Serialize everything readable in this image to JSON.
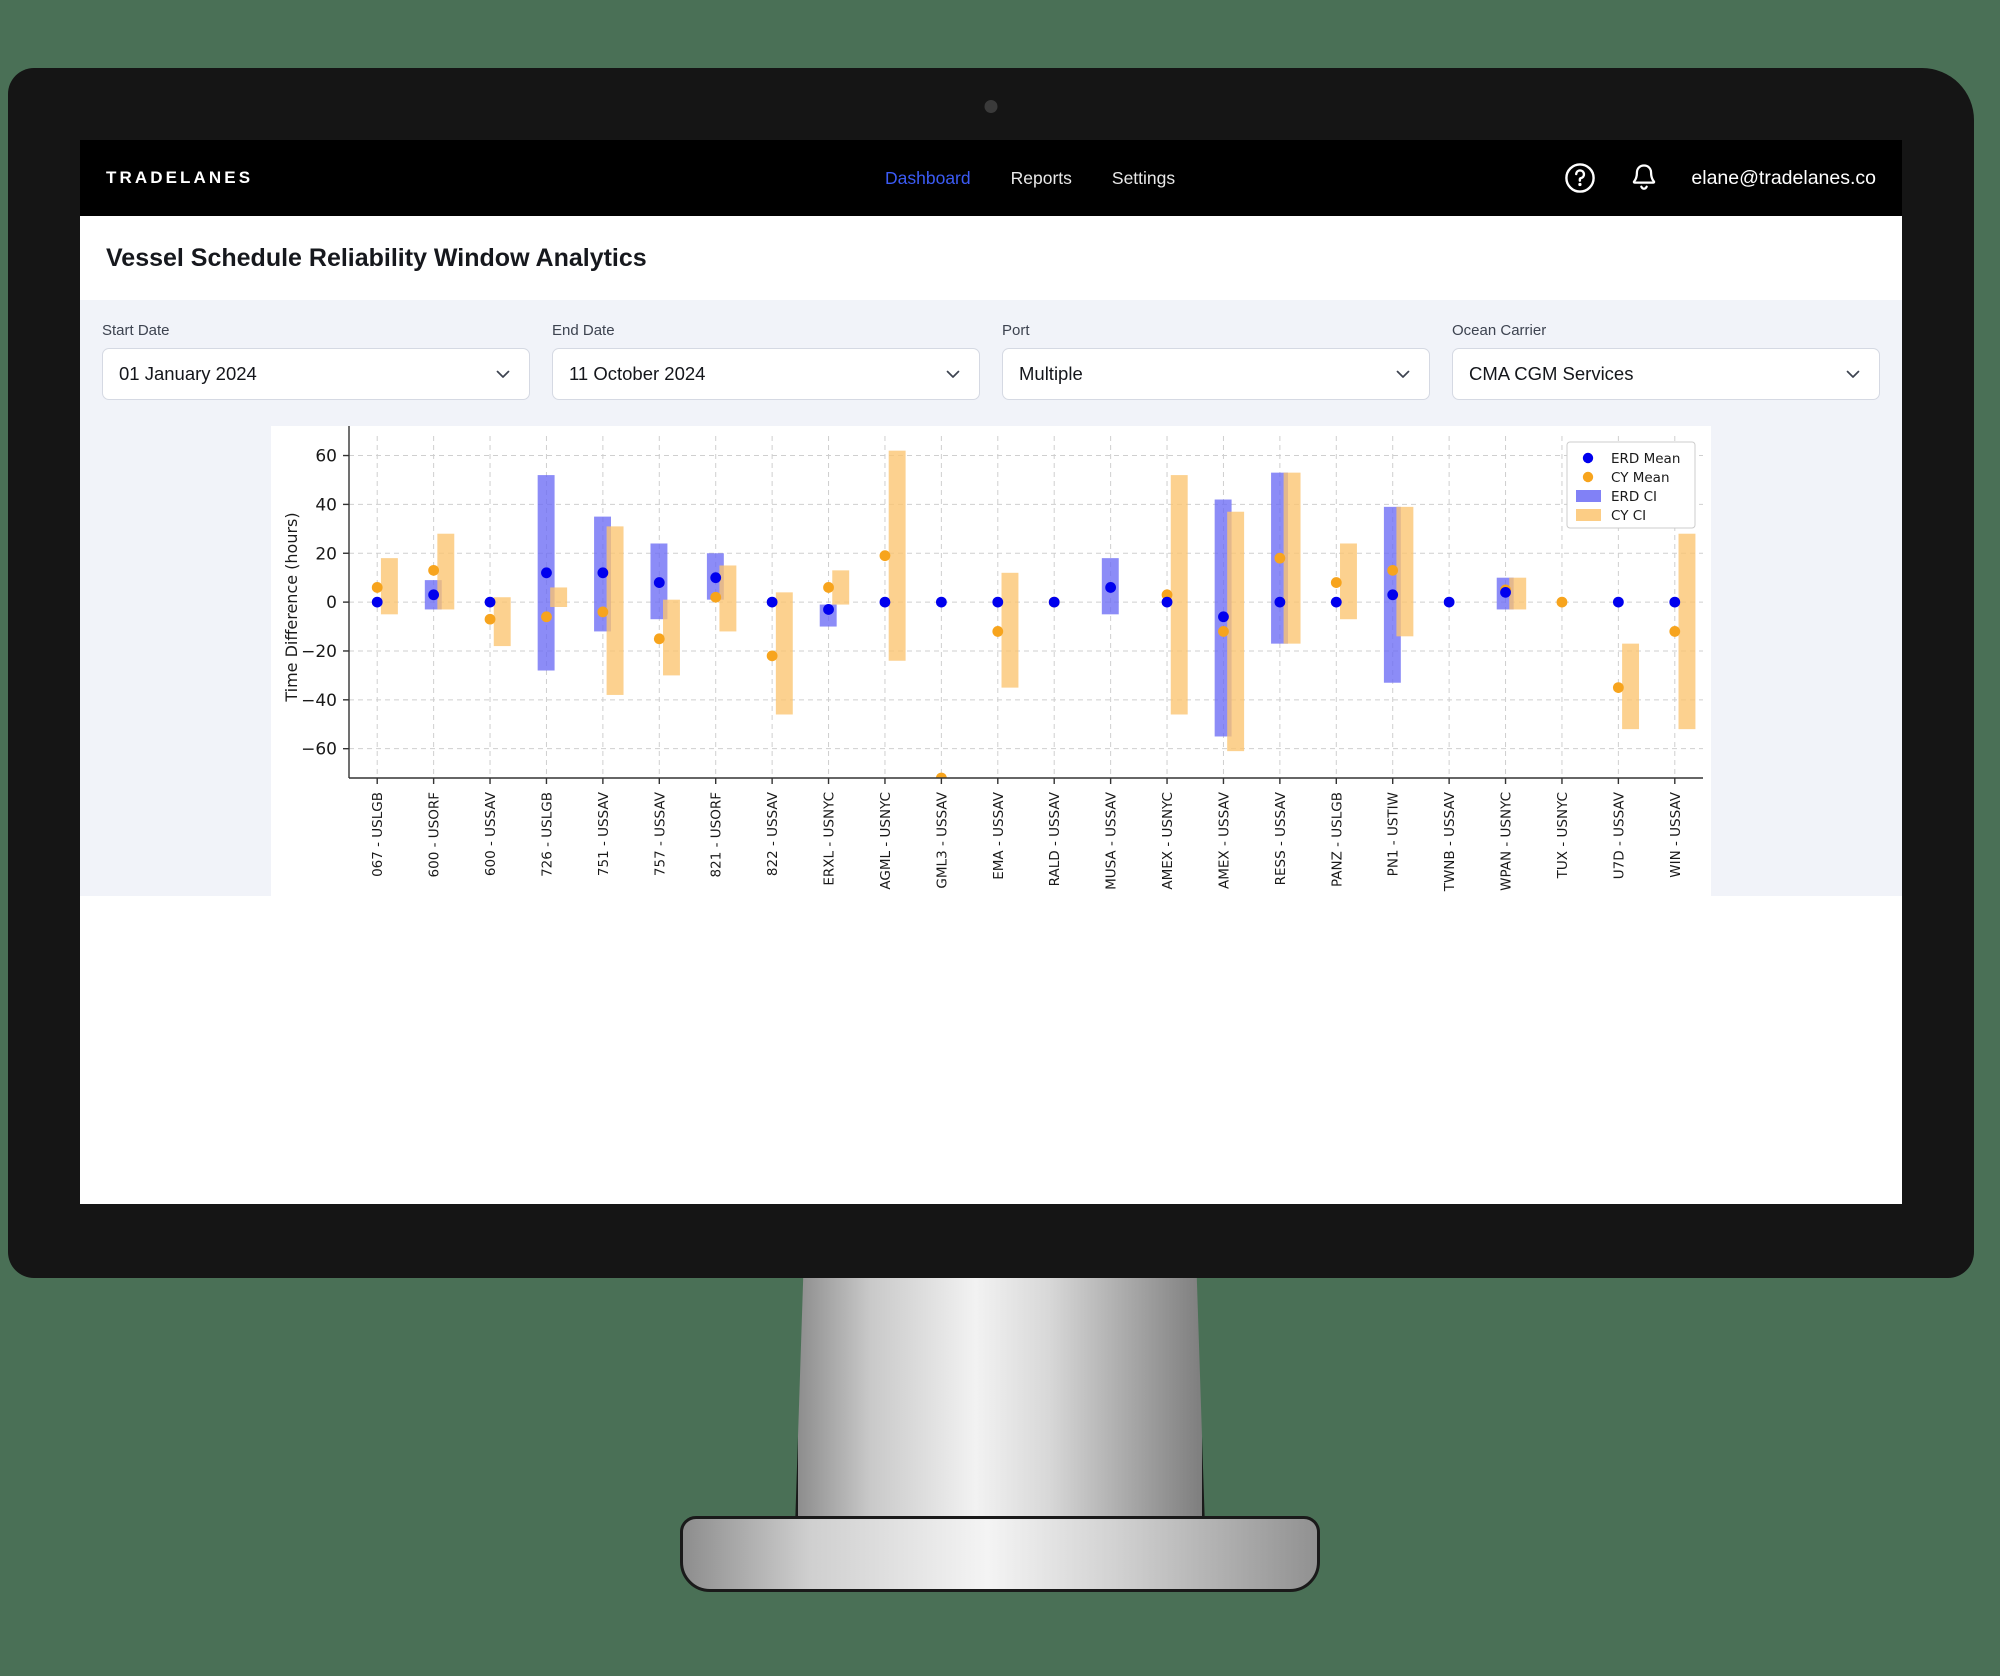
{
  "header": {
    "brand": "TRADELANES",
    "nav": [
      {
        "label": "Dashboard",
        "active": true
      },
      {
        "label": "Reports",
        "active": false
      },
      {
        "label": "Settings",
        "active": false
      }
    ],
    "help_icon": "help-circle-icon",
    "notification_icon": "bell-icon",
    "user_email": "elane@tradelanes.co"
  },
  "page_title": "Vessel Schedule Reliability Window Analytics",
  "filters": [
    {
      "label": "Start Date",
      "value": "01 January 2024",
      "name": "start-date"
    },
    {
      "label": "End Date",
      "value": "11 October 2024",
      "name": "end-date"
    },
    {
      "label": "Port",
      "value": "Multiple",
      "name": "port"
    },
    {
      "label": "Ocean Carrier",
      "value": "CMA CGM Services",
      "name": "ocean-carrier"
    }
  ],
  "colors": {
    "accent_blue": "#3b5bf5",
    "erd_mean": "#0000ee",
    "cy_mean": "#f7a41d",
    "erd_ci": "#6b6bf5",
    "cy_ci": "#fbc470",
    "header_bg": "#000000",
    "filter_bg": "#f1f3f9"
  },
  "chart_data": {
    "type": "bar",
    "title": "",
    "xlabel": "",
    "ylabel": "Time Difference (hours)",
    "ylim": [
      -72,
      68
    ],
    "yticks": [
      -60,
      -40,
      -20,
      0,
      20,
      40,
      60
    ],
    "ytick_labels": [
      "−60",
      "−40",
      "−20",
      "0",
      "20",
      "40",
      "60"
    ],
    "grid": true,
    "legend_position": "upper right",
    "legend": [
      {
        "label": "ERD Mean",
        "marker": "dot",
        "color": "#0000ee"
      },
      {
        "label": "CY Mean",
        "marker": "dot",
        "color": "#f7a41d"
      },
      {
        "label": "ERD CI",
        "marker": "bar",
        "color": "#6b6bf5"
      },
      {
        "label": "CY CI",
        "marker": "bar",
        "color": "#fbc470"
      }
    ],
    "categories": [
      "067 - USLGB",
      "600 - USORF",
      "600 - USSAV",
      "726 - USLGB",
      "751 - USSAV",
      "757 - USSAV",
      "821 - USORF",
      "822 - USSAV",
      "ERXL - USNYC",
      "AGML - USNYC",
      "GML3 - USSAV",
      "EMA - USSAV",
      "RALD - USSAV",
      "MUSA - USSAV",
      "AMEX - USNYC",
      "AMEX - USSAV",
      "RESS - USSAV",
      "PANZ - USLGB",
      "PN1 - USTIW",
      "TWNB - USSAV",
      "WPAN - USNYC",
      "TUX - USNYC",
      "U7D - USSAV",
      "WIN - USSAV"
    ],
    "series": [
      {
        "name": "ERD Mean",
        "type": "point",
        "color": "#0000ee",
        "values": [
          0,
          3,
          0,
          12,
          12,
          8,
          10,
          0,
          -3,
          0,
          0,
          0,
          0,
          6,
          0,
          -6,
          0,
          0,
          3,
          0,
          4,
          null,
          0,
          0
        ]
      },
      {
        "name": "CY Mean",
        "type": "point",
        "color": "#f7a41d",
        "values": [
          6,
          13,
          -7,
          -6,
          -4,
          -15,
          2,
          -22,
          6,
          19,
          -72,
          -12,
          0,
          null,
          3,
          -12,
          18,
          8,
          13,
          null,
          5,
          0,
          -35,
          -12
        ]
      },
      {
        "name": "ERD CI",
        "type": "interval",
        "color": "#6b6bf5",
        "low": [
          0,
          -3,
          0,
          -28,
          -12,
          -7,
          1,
          0,
          -10,
          0,
          0,
          0,
          0,
          -5,
          0,
          -55,
          -17,
          0,
          -33,
          0,
          -3,
          null,
          0,
          0
        ],
        "high": [
          0,
          9,
          0,
          52,
          35,
          24,
          20,
          0,
          -1,
          0,
          0,
          0,
          0,
          18,
          0,
          42,
          53,
          0,
          39,
          0,
          10,
          null,
          0,
          0
        ]
      },
      {
        "name": "CY CI",
        "type": "interval",
        "color": "#fbc470",
        "low": [
          -5,
          -3,
          -18,
          -2,
          -38,
          -30,
          -12,
          -46,
          -1,
          -24,
          -72,
          -35,
          0,
          0,
          -46,
          -61,
          -17,
          -7,
          -14,
          0,
          -3,
          0,
          -52,
          -52
        ],
        "high": [
          18,
          28,
          2,
          6,
          31,
          1,
          15,
          4,
          13,
          62,
          -72,
          12,
          0,
          0,
          52,
          37,
          53,
          24,
          39,
          0,
          10,
          0,
          -17,
          28
        ]
      }
    ]
  }
}
